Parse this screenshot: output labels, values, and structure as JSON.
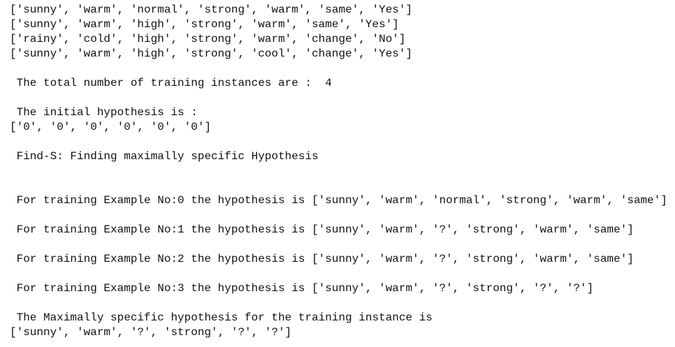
{
  "output": {
    "lines": [
      "['sunny', 'warm', 'normal', 'strong', 'warm', 'same', 'Yes']",
      "['sunny', 'warm', 'high', 'strong', 'warm', 'same', 'Yes']",
      "['rainy', 'cold', 'high', 'strong', 'warm', 'change', 'No']",
      "['sunny', 'warm', 'high', 'strong', 'cool', 'change', 'Yes']",
      "",
      " The total number of training instances are :  4",
      "",
      " The initial hypothesis is : ",
      "['0', '0', '0', '0', '0', '0']",
      "",
      " Find-S: Finding maximally specific Hypothesis",
      "",
      "",
      " For training Example No:0 the hypothesis is ['sunny', 'warm', 'normal', 'strong', 'warm', 'same']",
      "",
      " For training Example No:1 the hypothesis is ['sunny', 'warm', '?', 'strong', 'warm', 'same']",
      "",
      " For training Example No:2 the hypothesis is ['sunny', 'warm', '?', 'strong', 'warm', 'same']",
      "",
      " For training Example No:3 the hypothesis is ['sunny', 'warm', '?', 'strong', '?', '?']",
      "",
      " The Maximally specific hypothesis for the training instance is ",
      "['sunny', 'warm', '?', 'strong', '?', '?']"
    ]
  }
}
